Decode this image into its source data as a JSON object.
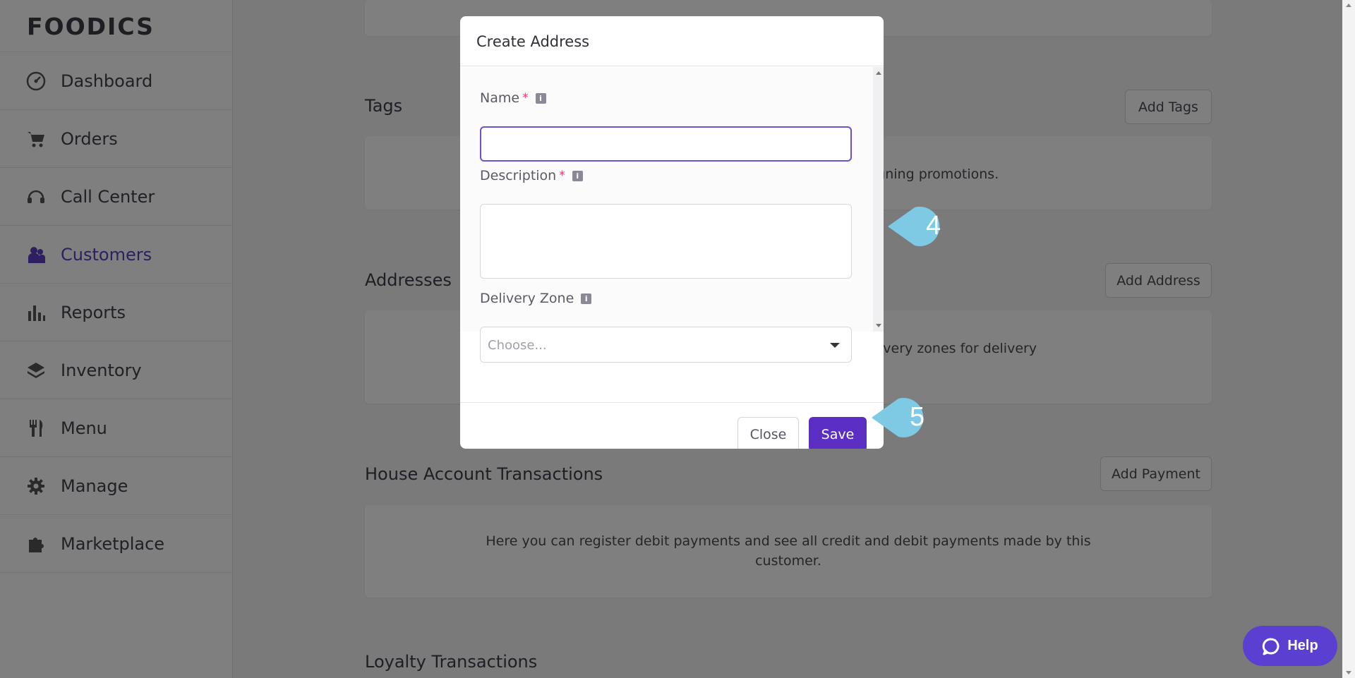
{
  "app": {
    "logo_text": "FOODICS"
  },
  "sidebar": {
    "items": [
      {
        "label": "Dashboard",
        "icon": "dashboard-gauge-icon"
      },
      {
        "label": "Orders",
        "icon": "cart-icon"
      },
      {
        "label": "Call Center",
        "icon": "headset-icon"
      },
      {
        "label": "Customers",
        "icon": "customers-icon",
        "active": true
      },
      {
        "label": "Reports",
        "icon": "bar-chart-icon"
      },
      {
        "label": "Inventory",
        "icon": "layers-icon"
      },
      {
        "label": "Menu",
        "icon": "fork-knife-icon"
      },
      {
        "label": "Manage",
        "icon": "gear-icon"
      },
      {
        "label": "Marketplace",
        "icon": "puzzle-icon"
      }
    ]
  },
  "main": {
    "tags": {
      "title": "Tags",
      "button": "Add Tags",
      "text": "signing promotions."
    },
    "addresses": {
      "title": "Addresses",
      "button": "Add Address",
      "text": "delivery zones for delivery"
    },
    "house_account": {
      "title": "House Account Transactions",
      "button": "Add Payment",
      "text_line1": "Here you can register debit payments and see all credit and debit payments made by this",
      "text_line2": "customer."
    },
    "loyalty": {
      "title": "Loyalty Transactions"
    }
  },
  "modal": {
    "title": "Create Address",
    "name_label": "Name",
    "name_value": "",
    "description_label": "Description",
    "description_value": "",
    "required_marker": "*",
    "delivery_zone_label": "Delivery Zone",
    "delivery_zone_placeholder": "Choose...",
    "info_glyph": "i",
    "close_label": "Close",
    "save_label": "Save"
  },
  "callouts": {
    "step4": "4",
    "step5": "5"
  },
  "help": {
    "label": "Help"
  },
  "colors": {
    "accent": "#5b2fc4",
    "callout": "#7ec9e4",
    "active_nav": "#5b3fc1",
    "help": "#5b3fd0"
  }
}
